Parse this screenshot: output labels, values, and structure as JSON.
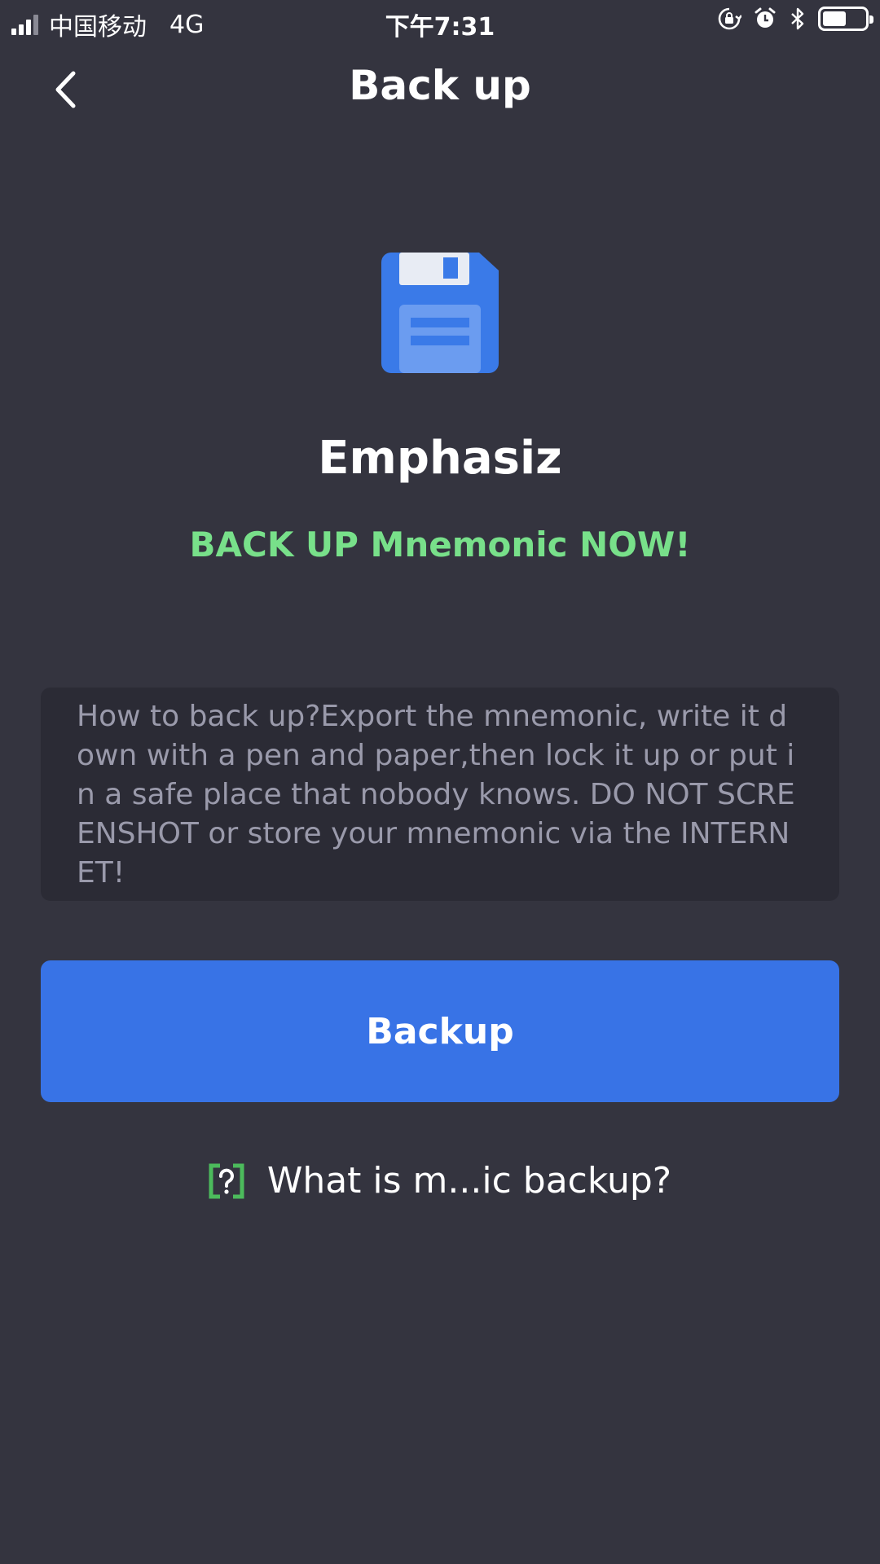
{
  "status_bar": {
    "carrier": "中国移动",
    "network": "4G",
    "time": "下午7:31",
    "battery_level": 0.55,
    "icons": [
      "signal-icon",
      "orientation-lock-icon",
      "alarm-icon",
      "bluetooth-icon",
      "battery-icon"
    ]
  },
  "nav": {
    "title": "Back up",
    "back_icon": "chevron-left-icon"
  },
  "main": {
    "icon": "floppy-disk-icon",
    "wallet_name": "Emphasiz",
    "warning": "BACK UP Mnemonic NOW!",
    "info": "How to back up?Export the mnemonic, write it down with a pen and paper,then lock it up or put in a safe place that nobody knows. DO NOT SCREENSHOT or store your mnemonic via the INTERNET!",
    "backup_button_label": "Backup",
    "help_icon": "question-mark-icon",
    "help_link_label": "What is m...ic backup?"
  },
  "colors": {
    "background": "#34343f",
    "info_box": "#2b2b35",
    "accent_blue": "#3873e6",
    "warning_green": "#78e08a",
    "info_text": "#9a9aab"
  }
}
